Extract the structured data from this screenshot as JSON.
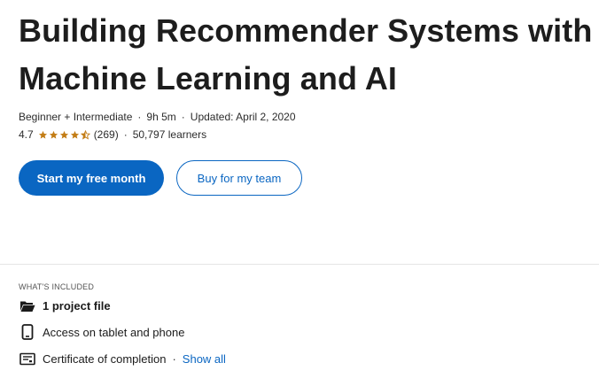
{
  "course": {
    "title": "Building Recommender Systems with Machine Learning and AI",
    "level": "Beginner + Intermediate",
    "duration": "9h 5m",
    "updated": "Updated: April 2, 2020",
    "rating_value": "4.7",
    "rating_count": "(269)",
    "learners": "50,797 learners",
    "stars": 4.7
  },
  "actions": {
    "primary_label": "Start my free month",
    "secondary_label": "Buy for my team"
  },
  "included": {
    "heading": "WHAT'S INCLUDED",
    "items": [
      {
        "label": "1 project file",
        "icon": "folder-icon"
      },
      {
        "label": "Access on tablet and phone",
        "icon": "tablet-icon"
      },
      {
        "label": "Certificate of completion",
        "icon": "certificate-icon"
      }
    ],
    "show_all_label": "Show all"
  },
  "colors": {
    "accent": "#0a66c2",
    "star": "#c37d16"
  }
}
